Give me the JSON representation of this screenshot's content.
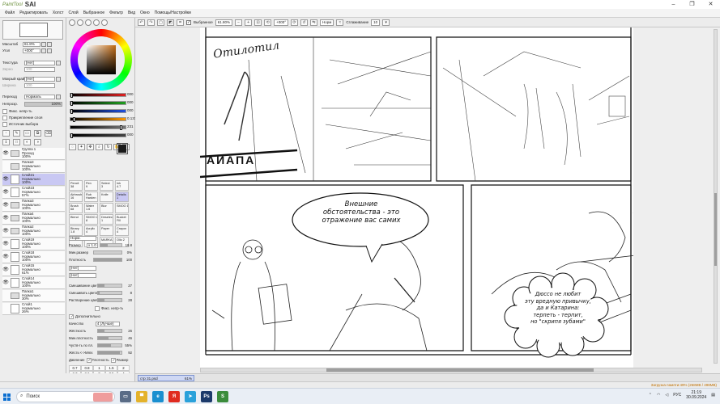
{
  "window": {
    "logo": "PaintTool",
    "app_name": "SAI",
    "controls": [
      "–",
      "❐",
      "✕"
    ]
  },
  "menu": [
    "Файл",
    "Редактировать",
    "Холст",
    "Слой",
    "Выбранное",
    "Фильтр",
    "Вид",
    "Окно",
    "Помощь/Настройки"
  ],
  "toolbar": {
    "select_label": "Выбранное",
    "zoom": "61.80%",
    "angle": "+000°",
    "blend_mode": "Норм",
    "stabilizer_label": "Сглаживание",
    "stabilizer_value": "10"
  },
  "navigator": {
    "zoom_label": "Масштаб",
    "zoom_value": "61.8%",
    "angle_label": "Угол",
    "angle_value": "+000°",
    "texture_label": "Текстура",
    "texture_value": "[Нет]",
    "texture_sub": "Зерно",
    "texture_sub_value": "100",
    "brush_label": "Мокрый край",
    "brush_value": "[Нет]",
    "brush_sub": "Ширина",
    "brush_sub_value": "100",
    "blend_label": "Переход",
    "blend_value": "Нормаль",
    "opacity_label": "Непрозр.",
    "opacity_value": "100%",
    "checks": [
      "Фикс. непр-ть",
      "Прикрепление слоя",
      "Источник выбора"
    ]
  },
  "layers": [
    {
      "name": "Группа 1",
      "sub": "Проход\n100%",
      "kind": "folder",
      "visible": true,
      "selected": false
    },
    {
      "name": "Папка3",
      "sub": "Нормально\n100%",
      "kind": "folder",
      "visible": false,
      "selected": false
    },
    {
      "name": "Слой21",
      "sub": "Нормально\n100%",
      "kind": "layer",
      "visible": true,
      "selected": true
    },
    {
      "name": "Слой23",
      "sub": "Нормально\n57%",
      "kind": "layer",
      "visible": true,
      "selected": false
    },
    {
      "name": "Папка3",
      "sub": "Нормально\n100%",
      "kind": "folder",
      "visible": true,
      "selected": false
    },
    {
      "name": "Папка4",
      "sub": "Нормально\n100%",
      "kind": "folder",
      "visible": true,
      "selected": false
    },
    {
      "name": "Папка2",
      "sub": "Нормально\n100%",
      "kind": "folder",
      "visible": true,
      "selected": false
    },
    {
      "name": "Слой19",
      "sub": "Нормально\n100%",
      "kind": "layer",
      "visible": true,
      "selected": false
    },
    {
      "name": "Слой18",
      "sub": "Нормально\n100%",
      "kind": "layer",
      "visible": true,
      "selected": false
    },
    {
      "name": "Слой15",
      "sub": "Нормально\n61%",
      "kind": "layer",
      "visible": true,
      "selected": false
    },
    {
      "name": "Слой14",
      "sub": "Нормально\n100%",
      "kind": "layer",
      "visible": true,
      "selected": false
    },
    {
      "name": "Папка1",
      "sub": "Нормально\n30%",
      "kind": "folder",
      "visible": false,
      "selected": false
    },
    {
      "name": "Слой1",
      "sub": "Нормально\n26%",
      "kind": "layer",
      "visible": false,
      "selected": false
    }
  ],
  "color": {
    "current_hex": "#1a1a1a",
    "sliders": [
      {
        "name": "R",
        "value": "000",
        "fill": 0.0,
        "color": "#e02020"
      },
      {
        "name": "G",
        "value": "000",
        "fill": 0.0,
        "color": "#20a020"
      },
      {
        "name": "B",
        "value": "000",
        "fill": 0.0,
        "color": "#2050e0"
      },
      {
        "name": "H",
        "value": "0.137",
        "fill": 0.04,
        "color": "#ff9900"
      },
      {
        "name": "S",
        "value": "231",
        "fill": 0.9,
        "color": "#777777"
      },
      {
        "name": "V",
        "value": "000",
        "fill": 0.0,
        "color": "#444444"
      }
    ]
  },
  "tools": [
    [
      "Pencil\n38",
      "Pen\n9",
      "Select\n3",
      "Ink\n4.7"
    ],
    [
      "Airbrush\n16",
      "Rub\nHarden",
      "Knife",
      "Details\n1"
    ],
    [
      "Brush\n68",
      "Water\n1.6",
      "Blur",
      "SMOO 1"
    ],
    [
      "Blend\n",
      "SMOO 2\n8",
      "Deselect\n1",
      "Bucket\nFill"
    ],
    [
      "Binary\n1.8",
      "Acrylic\n4",
      "Paper",
      "Crayon\n4"
    ],
    [
      "Blur",
      "Ollo 1",
      "MARKA",
      "Ollo 2"
    ]
  ],
  "brush_props": {
    "mode": "Норм.",
    "size_label": "Размер",
    "size_mult": "x 1.0",
    "size_value": "18.8",
    "min_size_label": "Мин.размер",
    "min_size_value": "0%",
    "density_label": "Плотность",
    "density_value": "100",
    "shape_label": "[Нет]",
    "texture_label": "[Нет]",
    "blending_label": "Смешивание цвет.",
    "blending_value": "27",
    "dilution_label": "Смешивать цвета",
    "dilution_value": "8",
    "persistence_label": "Растворение цвет.",
    "persistence_value": "28",
    "keep_opacity": "Фикс. непр-ть",
    "advanced": "Дополнительно",
    "quality_label": "Качество",
    "quality_value": "4 (Лучше)",
    "hardness_label": "Жёсткость",
    "hardness_value": "26",
    "min_density_label": "Мин.плотность",
    "min_density_value": "46",
    "sensitivity_label": "Чуств-ть по пл.",
    "sensitivity_value": "55%",
    "hardsoft_label": "Жёстк.<->Мягк",
    "hardsoft_value": "92",
    "pressure_label": "Давление",
    "pressure_density": "Плотность",
    "pressure_size": "Размер"
  },
  "brush_sizes": [
    "0.7",
    "0.8",
    "1",
    "1.5",
    "2",
    "2.3",
    "2.6",
    "3",
    "3.5",
    "4"
  ],
  "document": {
    "tab_name": "стр 31.psd",
    "tab_zoom": "61%"
  },
  "speech": {
    "bubble1": "Внешние\nобстоятельства - это\nотражение вас самих",
    "bubble2": "Дюссо не любит\nэту вредную привычку,\nда и Катарина:\nтерпеть - терпит,\nно \"скрипя зубами\"",
    "sign": "АИАПА",
    "scribble": "Отилотил"
  },
  "status": {
    "memory": "Загрузка памяти:49% (268MB / 498MB)"
  },
  "taskbar": {
    "search_text": "Поиск",
    "lang": "РУС",
    "time": "21:19",
    "date": "30.09.2024",
    "apps": [
      {
        "name": "task-view",
        "color": "#5a6c86",
        "glyph": "▭"
      },
      {
        "name": "explorer",
        "color": "#e4b22b",
        "glyph": "▀"
      },
      {
        "name": "edge",
        "color": "#1a8fd0",
        "glyph": "e"
      },
      {
        "name": "yandex",
        "color": "#e02b20",
        "glyph": "Я"
      },
      {
        "name": "telegram",
        "color": "#2aa1da",
        "glyph": "➤"
      },
      {
        "name": "photoshop",
        "color": "#1c3a6b",
        "glyph": "Ps"
      },
      {
        "name": "paint-tool-sai",
        "color": "#3b8c3b",
        "glyph": "S"
      }
    ]
  }
}
